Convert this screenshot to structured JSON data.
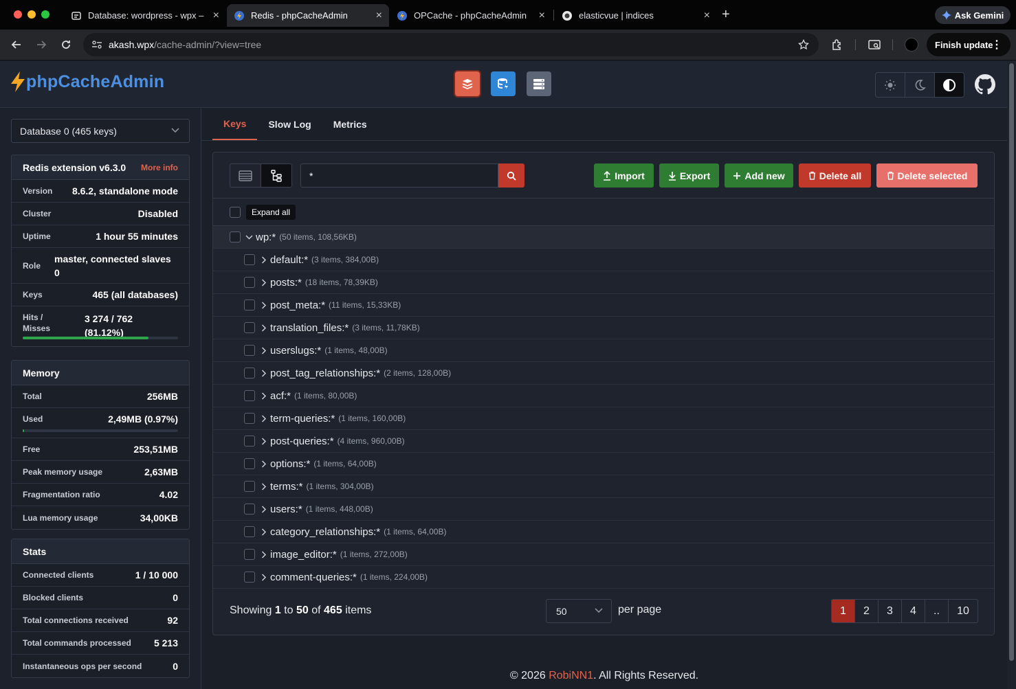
{
  "browser": {
    "tabs": [
      {
        "title": "Database: wordpress - wpx –",
        "active": false
      },
      {
        "title": "Redis - phpCacheAdmin",
        "active": true
      },
      {
        "title": "OPCache - phpCacheAdmin",
        "active": false
      },
      {
        "title": "elasticvue | indices",
        "active": false
      }
    ],
    "ask_gemini": "Ask Gemini",
    "url_host": "akash.wpx",
    "url_path": "/cache-admin/?view=tree",
    "finish_update": "Finish update"
  },
  "header": {
    "logo_text": "phpCacheAdmin",
    "nav_icons": [
      "redis-icon",
      "memcached-icon",
      "server-icon"
    ],
    "theme_icons": [
      "sun-icon",
      "moon-icon",
      "contrast-icon"
    ],
    "accent": "#e0634e"
  },
  "sidebar": {
    "database_select": "Database 0 (465 keys)",
    "info": {
      "title": "Redis extension v6.3.0",
      "more_info": "More info",
      "rows": [
        {
          "key": "Version",
          "value": "8.6.2, standalone mode"
        },
        {
          "key": "Cluster",
          "value": "Disabled"
        },
        {
          "key": "Uptime",
          "value": "1 hour 55 minutes"
        },
        {
          "key": "Role",
          "value": "master, connected slaves 0"
        },
        {
          "key": "Keys",
          "value": "465 (all databases)"
        },
        {
          "key": "Hits / Misses",
          "value": "3 274 / 762 (81.12%)"
        }
      ],
      "hit_ratio": 0.8112
    },
    "memory": {
      "title": "Memory",
      "total": {
        "key": "Total",
        "value": "256MB"
      },
      "used": {
        "key": "Used",
        "value": "2,49MB (0.97%)"
      },
      "used_ratio": 0.0097,
      "rows": [
        {
          "key": "Free",
          "value": "253,51MB"
        },
        {
          "key": "Peak memory usage",
          "value": "2,63MB"
        },
        {
          "key": "Fragmentation ratio",
          "value": "4.02"
        },
        {
          "key": "Lua memory usage",
          "value": "34,00KB"
        }
      ]
    },
    "stats": {
      "title": "Stats",
      "rows": [
        {
          "key": "Connected clients",
          "value": "1 / 10 000"
        },
        {
          "key": "Blocked clients",
          "value": "0"
        },
        {
          "key": "Total connections received",
          "value": "92"
        },
        {
          "key": "Total commands processed",
          "value": "5 213"
        },
        {
          "key": "Instantaneous ops per second",
          "value": "0"
        }
      ]
    }
  },
  "main": {
    "tabs": [
      {
        "label": "Keys",
        "active": true
      },
      {
        "label": "Slow Log",
        "active": false
      },
      {
        "label": "Metrics",
        "active": false
      }
    ],
    "search_value": "*",
    "actions": {
      "import": "Import",
      "export": "Export",
      "add_new": "Add new",
      "delete_all": "Delete all",
      "delete_selected": "Delete selected"
    },
    "expand_all": "Expand all",
    "tree": {
      "root": {
        "name": "wp:*",
        "meta": "(50 items, 108,56KB)"
      },
      "children": [
        {
          "name": "default:*",
          "meta": "(3 items, 384,00B)"
        },
        {
          "name": "posts:*",
          "meta": "(18 items, 78,39KB)"
        },
        {
          "name": "post_meta:*",
          "meta": "(11 items, 15,33KB)"
        },
        {
          "name": "translation_files:*",
          "meta": "(3 items, 11,78KB)"
        },
        {
          "name": "userslugs:*",
          "meta": "(1 items, 48,00B)"
        },
        {
          "name": "post_tag_relationships:*",
          "meta": "(2 items, 128,00B)"
        },
        {
          "name": "acf:*",
          "meta": "(1 items, 80,00B)"
        },
        {
          "name": "term-queries:*",
          "meta": "(1 items, 160,00B)"
        },
        {
          "name": "post-queries:*",
          "meta": "(4 items, 960,00B)"
        },
        {
          "name": "options:*",
          "meta": "(1 items, 64,00B)"
        },
        {
          "name": "terms:*",
          "meta": "(1 items, 304,00B)"
        },
        {
          "name": "users:*",
          "meta": "(1 items, 448,00B)"
        },
        {
          "name": "category_relationships:*",
          "meta": "(1 items, 64,00B)"
        },
        {
          "name": "image_editor:*",
          "meta": "(1 items, 272,00B)"
        },
        {
          "name": "comment-queries:*",
          "meta": "(1 items, 224,00B)"
        }
      ]
    },
    "pagination": {
      "showing_prefix": "Showing",
      "from": "1",
      "to_word": "to",
      "to": "50",
      "of_word": "of",
      "total": "465",
      "items_word": "items",
      "per_page_value": "50",
      "per_page_label": "per page",
      "pages": [
        "1",
        "2",
        "3",
        "4",
        "..",
        "10"
      ],
      "current": "1"
    }
  },
  "footer": {
    "prefix": "© 2026 ",
    "brand": "RobiNN1",
    "suffix": ". All Rights Reserved."
  }
}
